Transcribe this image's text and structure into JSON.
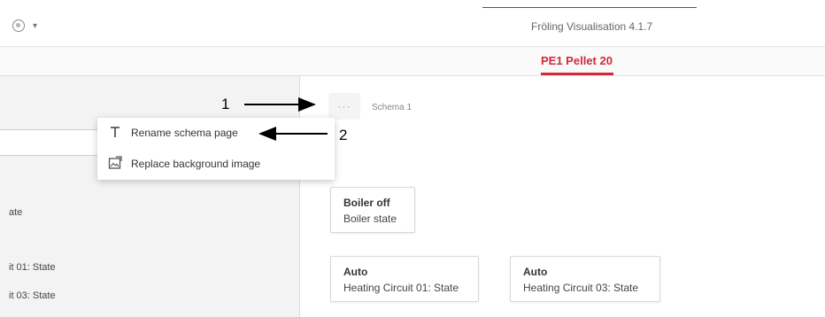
{
  "header": {
    "app_title": "Fröling Visualisation 4.1.7",
    "user_menu_caret": "▾"
  },
  "tabs": [
    {
      "label": "PE1 Pellet 20",
      "active": true
    }
  ],
  "left_panel": {
    "items": [
      "ate",
      "it 01: State",
      "it 03: State"
    ]
  },
  "schema": {
    "more_label": "···",
    "page_name": "Schema 1"
  },
  "context_menu": {
    "items": [
      {
        "icon": "text-t-icon",
        "label": "Rename schema page"
      },
      {
        "icon": "image-replace-icon",
        "label": "Replace background image"
      }
    ]
  },
  "cards": [
    {
      "value": "Boiler off",
      "label": "Boiler state"
    },
    {
      "value": "Auto",
      "label": "Heating Circuit 01: State"
    },
    {
      "value": "Auto",
      "label": "Heating Circuit 03: State"
    }
  ],
  "annotations": [
    "1",
    "2"
  ],
  "colors": {
    "accent": "#d4283c"
  }
}
